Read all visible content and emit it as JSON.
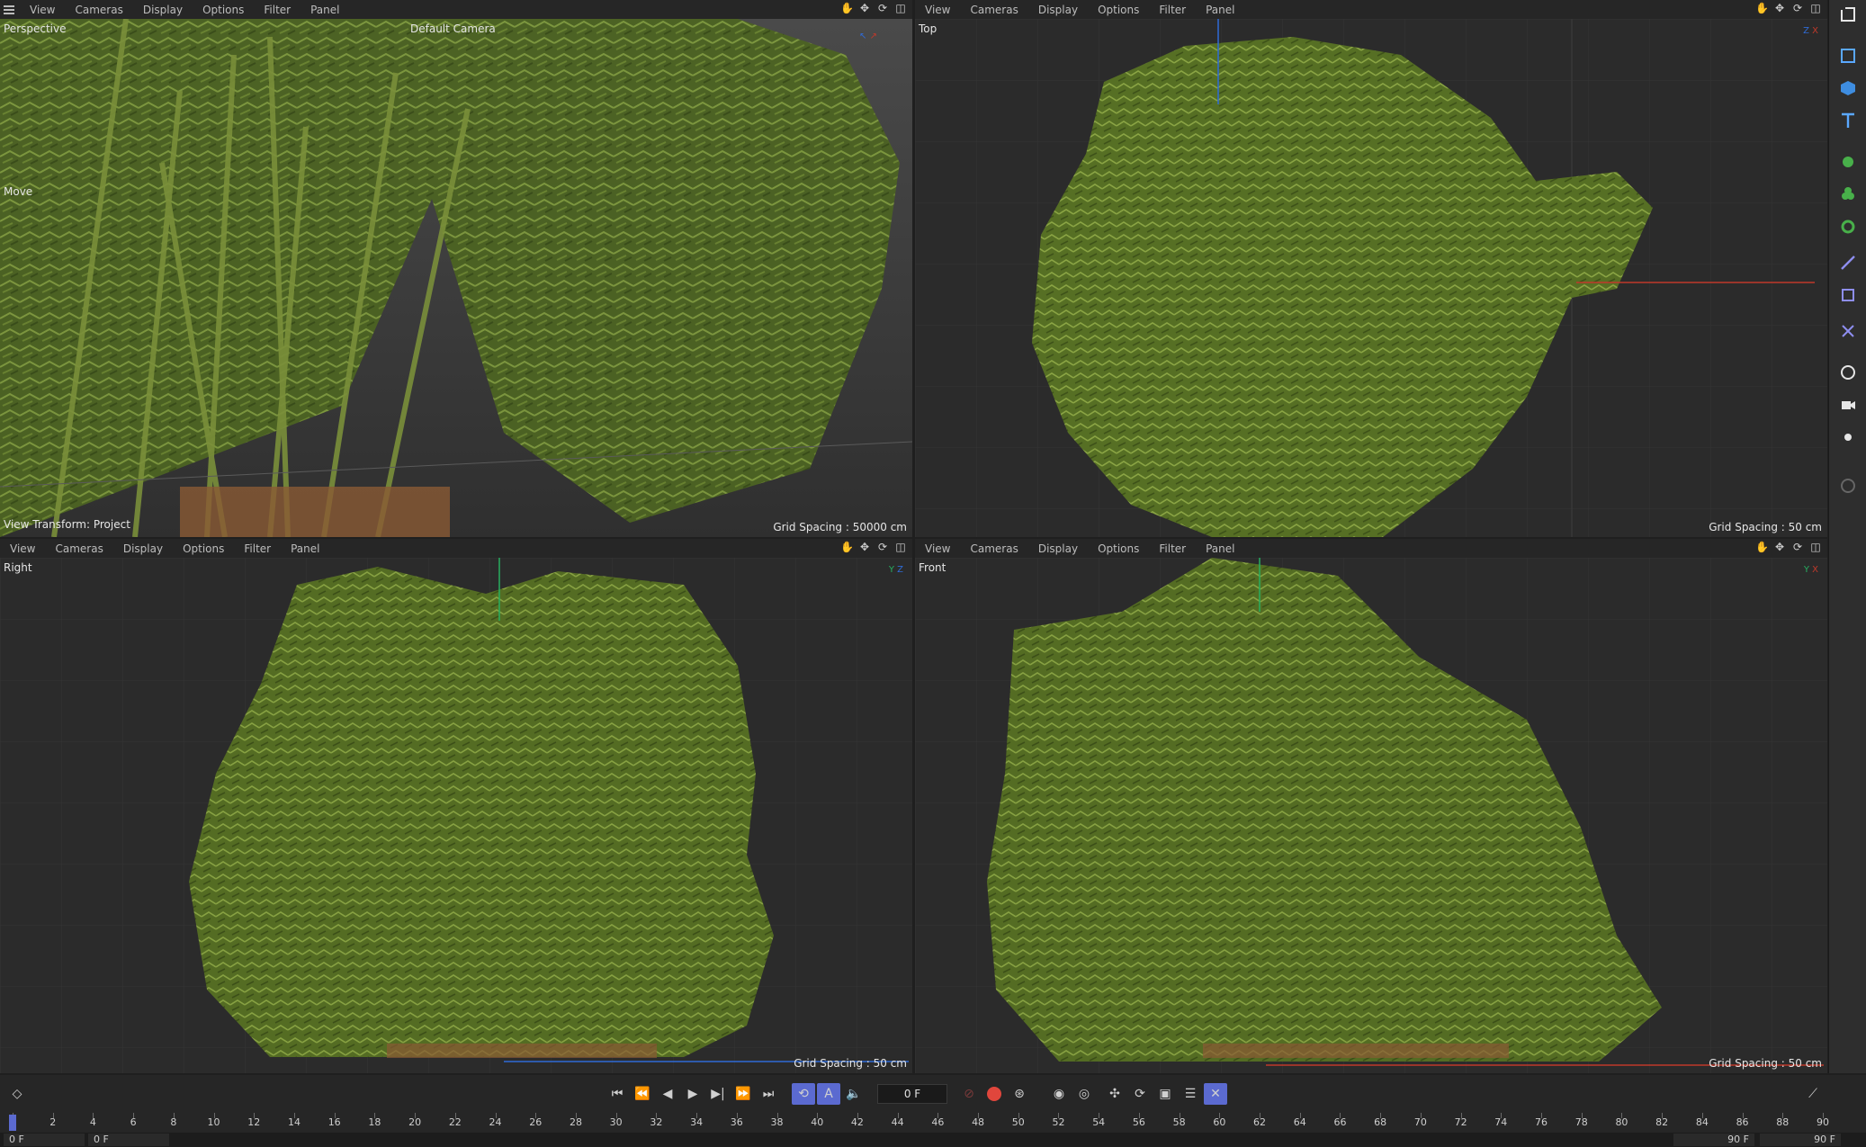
{
  "top_menu": {
    "items": [
      "View",
      "Cameras",
      "Display",
      "Options",
      "Filter",
      "Panel"
    ]
  },
  "viewports": {
    "perspective": {
      "menu": [
        "View",
        "Cameras",
        "Display",
        "Options",
        "Filter",
        "Panel"
      ],
      "name": "Perspective",
      "camera": "Default Camera",
      "tool": "Move",
      "view_transform": "View Transform: Project",
      "grid_spacing": "Grid Spacing : 50000 cm"
    },
    "top": {
      "menu": [
        "View",
        "Cameras",
        "Display",
        "Options",
        "Filter",
        "Panel"
      ],
      "name": "Top",
      "grid_spacing": "Grid Spacing : 50 cm"
    },
    "right": {
      "menu": [
        "View",
        "Cameras",
        "Display",
        "Options",
        "Filter",
        "Panel"
      ],
      "name": "Right",
      "grid_spacing": "Grid Spacing : 50 cm"
    },
    "front": {
      "menu": [
        "View",
        "Cameras",
        "Display",
        "Options",
        "Filter",
        "Panel"
      ],
      "name": "Front",
      "grid_spacing": "Grid Spacing : 50 cm"
    }
  },
  "axis_labels": {
    "x": "X",
    "y": "Y",
    "z": "Z"
  },
  "timeline": {
    "current_frame": "0 F",
    "start_frame": "0 F",
    "preview_start": "0 F",
    "end_frame": "90 F",
    "preview_end": "90 F",
    "ruler_labels": [
      "0",
      "2",
      "4",
      "6",
      "8",
      "10",
      "12",
      "14",
      "16",
      "18",
      "20",
      "22",
      "24",
      "26",
      "28",
      "30",
      "32",
      "34",
      "36",
      "38",
      "40",
      "42",
      "44",
      "46",
      "48",
      "50",
      "52",
      "54",
      "56",
      "58",
      "60",
      "62",
      "64",
      "66",
      "68",
      "70",
      "72",
      "74",
      "76",
      "78",
      "80",
      "82",
      "84",
      "86",
      "88",
      "90"
    ]
  },
  "colors": {
    "accent": "#5b6ad0",
    "foliage": "#5d7a2a",
    "axis_x": "#c0392b",
    "axis_y": "#27ae60",
    "axis_z": "#2f6bd6",
    "record": "#e0463c"
  },
  "icons": {
    "right_toolbar": [
      "view-icon",
      "cube-primitive-icon",
      "cube-icon",
      "text-icon",
      "generator-icon",
      "cloner-icon",
      "gear-icon",
      "spline-icon",
      "deformer-icon",
      "field-icon",
      "environment-icon",
      "camera-icon",
      "light-icon",
      "pen-icon"
    ]
  }
}
